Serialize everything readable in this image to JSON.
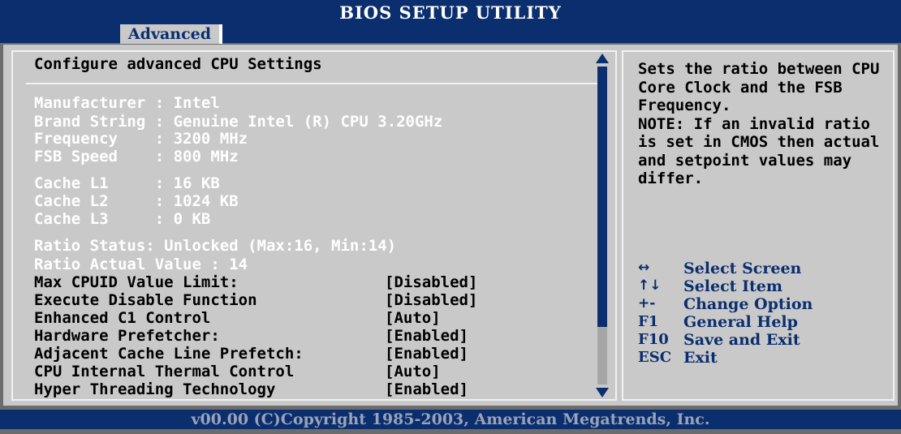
{
  "header": {
    "title": "BIOS SETUP UTILITY",
    "active_tab": "Advanced"
  },
  "panel": {
    "title": "Configure advanced CPU Settings"
  },
  "info": [
    "Manufacturer : Intel",
    "Brand String : Genuine Intel (R) CPU 3.20GHz",
    "Frequency    : 3200 MHz",
    "FSB Speed    : 800 MHz",
    "Cache L1     : 16 KB",
    "Cache L2     : 1024 KB",
    "Cache L3     : 0 KB",
    "Ratio Status: Unlocked (Max:16, Min:14)",
    "Ratio Actual Value : 14"
  ],
  "options": [
    {
      "label": "Max CPUID Value Limit:",
      "value": "[Disabled]"
    },
    {
      "label": "Execute Disable Function",
      "value": "[Disabled]"
    },
    {
      "label": "Enhanced C1 Control",
      "value": "[Auto]"
    },
    {
      "label": "Hardware Prefetcher:",
      "value": "[Enabled]"
    },
    {
      "label": "Adjacent Cache Line Prefetch:",
      "value": "[Enabled]"
    },
    {
      "label": "CPU Internal Thermal Control",
      "value": "[Auto]"
    },
    {
      "label": "Hyper Threading Technology",
      "value": "[Enabled]"
    }
  ],
  "help": {
    "text": "Sets the ratio between CPU Core Clock and the FSB Frequency.\nNOTE: If an invalid ratio is set in CMOS then actual and setpoint values may differ."
  },
  "keys": [
    {
      "key": "↔",
      "icon": "left-right-arrow-icon",
      "desc": "Select Screen"
    },
    {
      "key": "↑↓",
      "icon": "up-down-arrow-icon",
      "desc": "Select Item"
    },
    {
      "key": "+-",
      "icon": "plus-minus-icon",
      "desc": "Change Option"
    },
    {
      "key": "F1",
      "desc": "General Help"
    },
    {
      "key": "F10",
      "desc": "Save and Exit"
    },
    {
      "key": "ESC",
      "desc": "Exit"
    }
  ],
  "footer": {
    "text": "v00.00 (C)Copyright 1985-2003, American Megatrends, Inc."
  },
  "colors": {
    "header_blue": "#0b2e6e",
    "panel_gray": "#c9c9c9",
    "info_text": "#ffffff"
  },
  "scrollbar": {
    "thumb_fraction": 0.82
  }
}
